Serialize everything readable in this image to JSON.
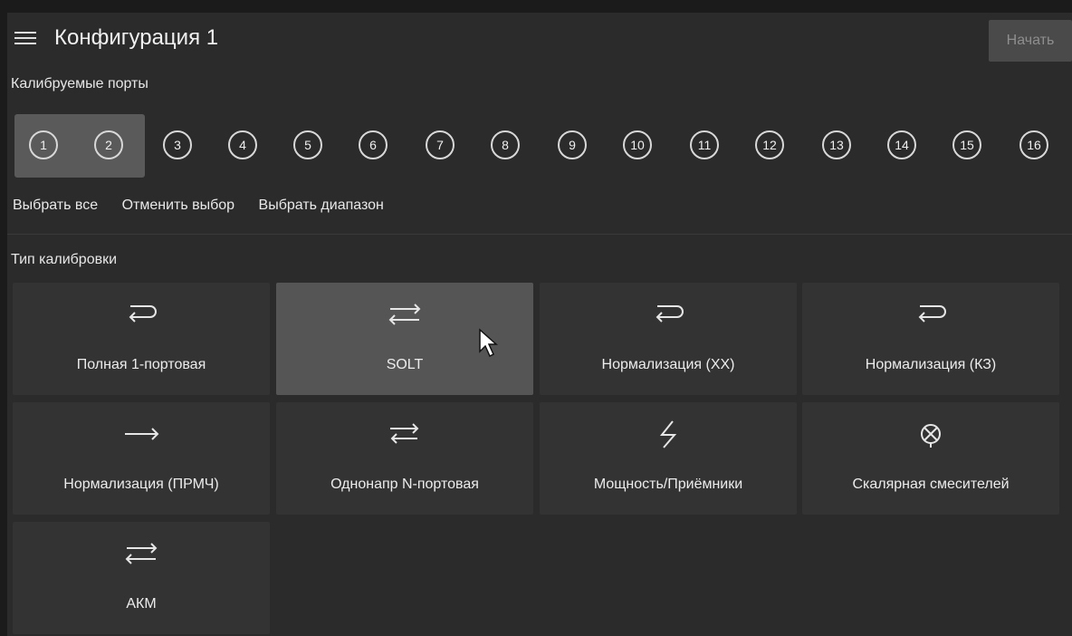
{
  "header": {
    "title": "Конфигурация 1",
    "start_label": "Начать"
  },
  "ports_section": {
    "label": "Калибруемые порты",
    "ports": [
      "1",
      "2",
      "3",
      "4",
      "5",
      "6",
      "7",
      "8",
      "9",
      "10",
      "11",
      "12",
      "13",
      "14",
      "15",
      "16"
    ],
    "selected": [
      "1",
      "2"
    ]
  },
  "actions": {
    "select_all": "Выбрать все",
    "deselect": "Отменить выбор",
    "select_range": "Выбрать диапазон"
  },
  "calibration": {
    "label": "Тип калибровки",
    "types": [
      {
        "label": "Полная 1-портовая",
        "icon": "return-arrow-icon"
      },
      {
        "label": "SOLT",
        "icon": "bidirectional-arrows-icon",
        "selected": true
      },
      {
        "label": "Нормализация (XX)",
        "icon": "return-arrow-icon"
      },
      {
        "label": "Нормализация (КЗ)",
        "icon": "return-arrow-icon"
      },
      {
        "label": "Нормализация (ПРМЧ)",
        "icon": "right-arrow-icon"
      },
      {
        "label": "Однонапр N-портовая",
        "icon": "unidirectional-return-arrow-icon"
      },
      {
        "label": "Мощность/Приёмники",
        "icon": "lightning-icon"
      },
      {
        "label": "Скалярная смесителей",
        "icon": "mixer-icon"
      },
      {
        "label": "АКМ",
        "icon": "bidirectional-arrows-icon"
      }
    ]
  },
  "colors": {
    "panel": "#2b2b2b",
    "tile": "#333333",
    "tile_selected": "#555555"
  }
}
